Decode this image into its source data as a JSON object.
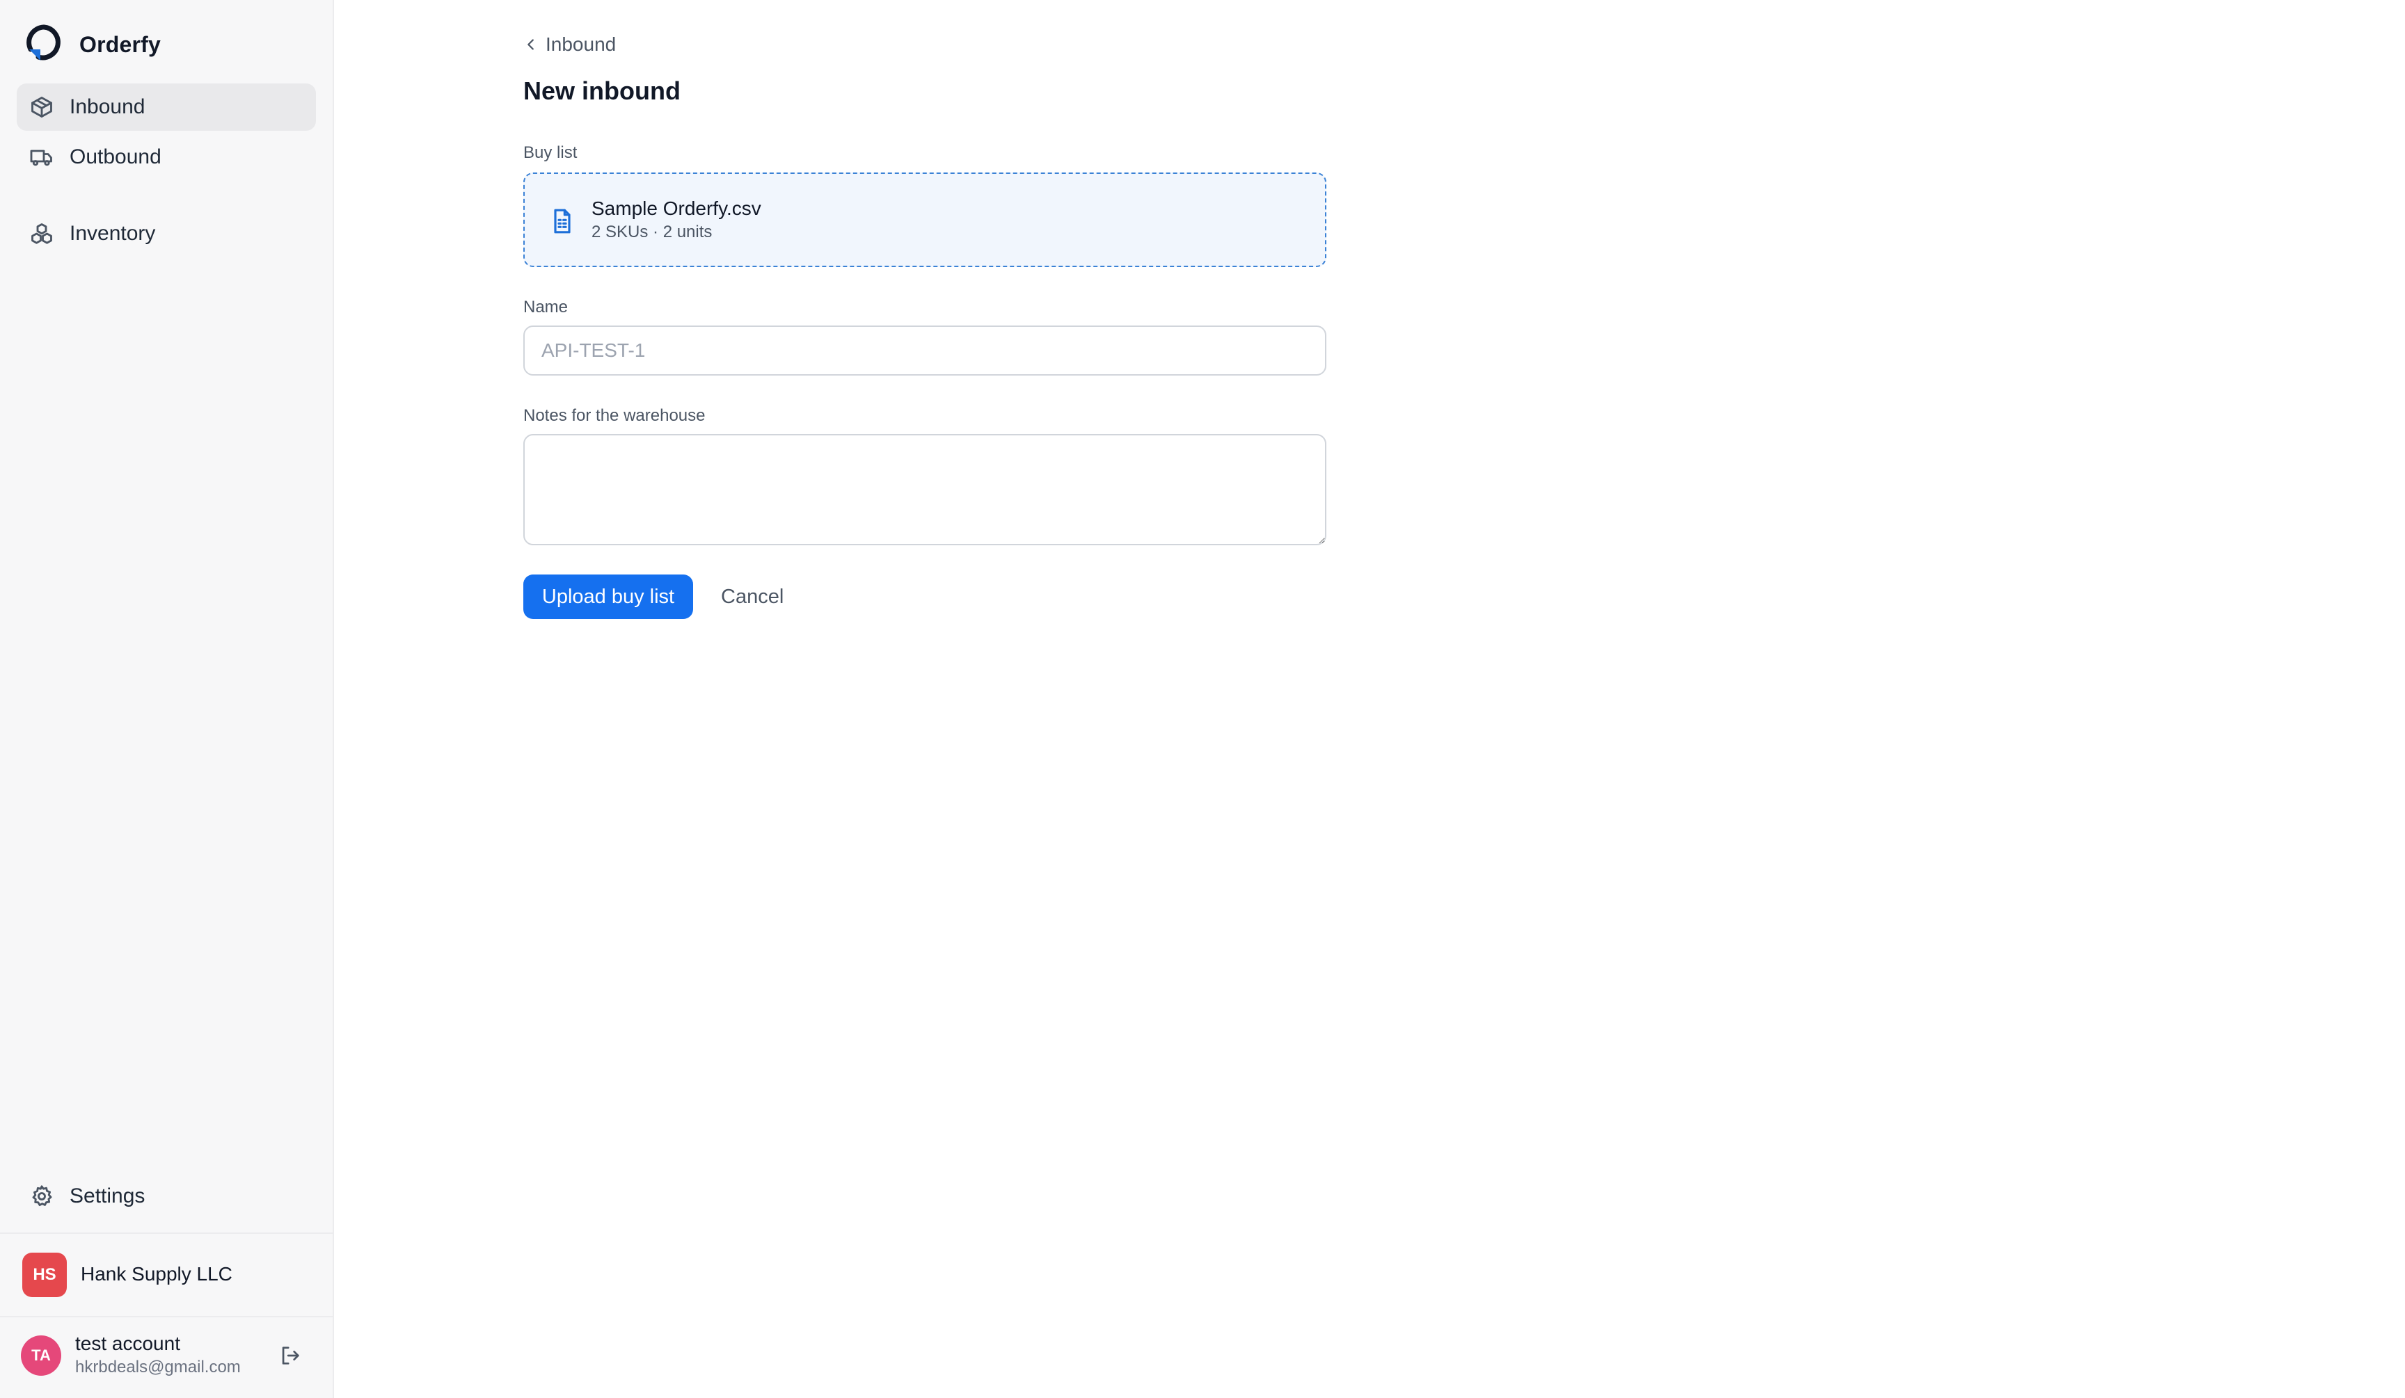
{
  "app": {
    "name": "Orderfy"
  },
  "sidebar": {
    "items": [
      {
        "id": "inbound",
        "label": "Inbound",
        "icon": "package-icon",
        "active": true
      },
      {
        "id": "outbound",
        "label": "Outbound",
        "icon": "truck-icon",
        "active": false
      },
      {
        "id": "inventory",
        "label": "Inventory",
        "icon": "boxes-icon",
        "active": false
      }
    ],
    "settings": {
      "label": "Settings",
      "icon": "gear-icon"
    },
    "org": {
      "initials": "HS",
      "name": "Hank Supply LLC",
      "color": "#e5484d"
    },
    "user": {
      "initials": "TA",
      "name": "test account",
      "email": "hkrbdeals@gmail.com",
      "color": "#e5487a"
    }
  },
  "main": {
    "breadcrumb": "Inbound",
    "title": "New inbound",
    "buy_list": {
      "label": "Buy list",
      "file_name": "Sample Orderfy.csv",
      "file_meta": "2 SKUs · 2 units"
    },
    "name_field": {
      "label": "Name",
      "placeholder": "API-TEST-1",
      "value": ""
    },
    "notes_field": {
      "label": "Notes for the warehouse",
      "value": ""
    },
    "actions": {
      "submit_label": "Upload buy list",
      "cancel_label": "Cancel"
    }
  },
  "colors": {
    "accent": "#1570ef",
    "dropzone_border": "#3b82d6",
    "dropzone_bg": "#f1f6fd",
    "sidebar_bg": "#f7f7f8"
  }
}
